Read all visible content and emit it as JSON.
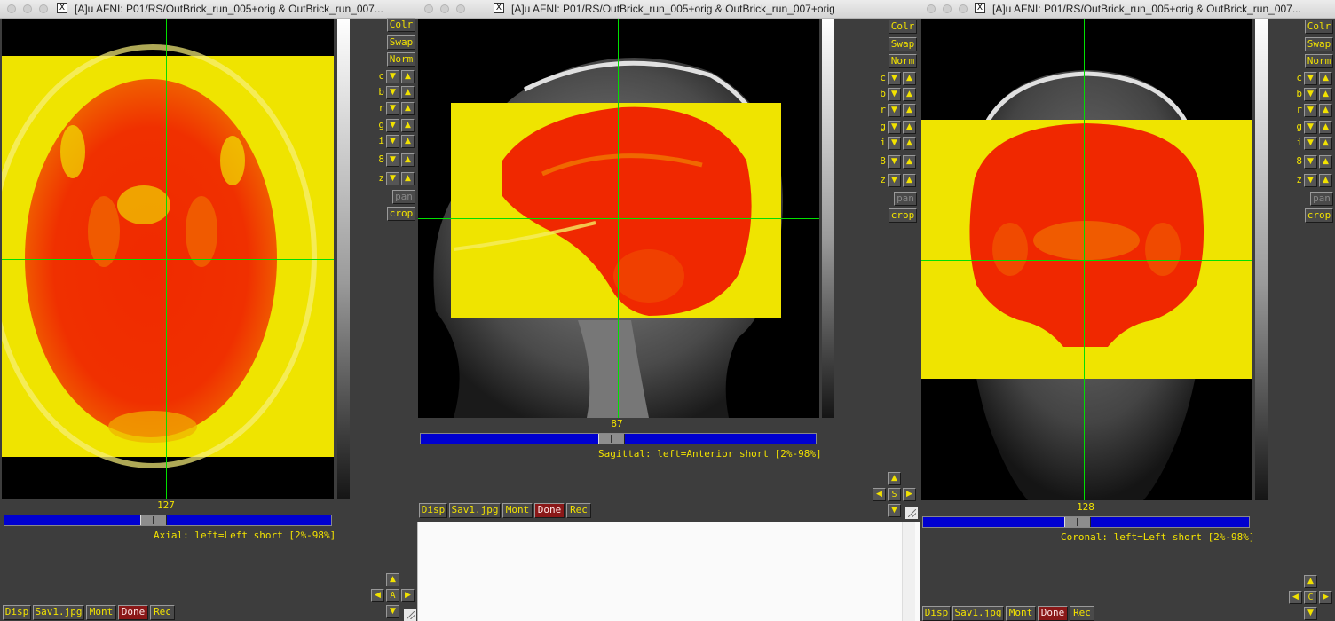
{
  "windows": [
    {
      "id": "axial",
      "title": "[A]u AFNI: P01/RS/OutBrick_run_005+orig & OutBrick_run_007...",
      "slice_number": "127",
      "slider_position": 0.45,
      "label": "Axial: left=Left short [2%-98%]",
      "orient_button": "A"
    },
    {
      "id": "sagittal",
      "title": "[A]u AFNI: P01/RS/OutBrick_run_005+orig & OutBrick_run_007+orig",
      "slice_number": "87",
      "slider_position": 0.48,
      "label": "Sagittal: left=Anterior short [2%-98%]",
      "orient_button": "S"
    },
    {
      "id": "coronal",
      "title": "[A]u AFNI: P01/RS/OutBrick_run_005+orig & OutBrick_run_007...",
      "slice_number": "128",
      "slider_position": 0.47,
      "label": "Coronal: left=Left short [2%-98%]",
      "orient_button": "C"
    }
  ],
  "side_buttons": {
    "colr": "Colr",
    "swap": "Swap",
    "norm": "Norm",
    "pan": "pan",
    "crop": "crop"
  },
  "side_rows": [
    "c",
    "b",
    "r",
    "g",
    "i",
    "8",
    "z"
  ],
  "bottom_buttons": {
    "disp": "Disp",
    "save": "Sav1.jpg",
    "mont": "Mont",
    "done": "Done",
    "rec": "Rec"
  },
  "colors": {
    "overlay_yellow": "#f0e600",
    "overlay_red": "#f02000",
    "crosshair": "#00e000",
    "slider_blue": "#0000d0",
    "button_text": "#f2e200",
    "done_red": "#8a1818"
  }
}
